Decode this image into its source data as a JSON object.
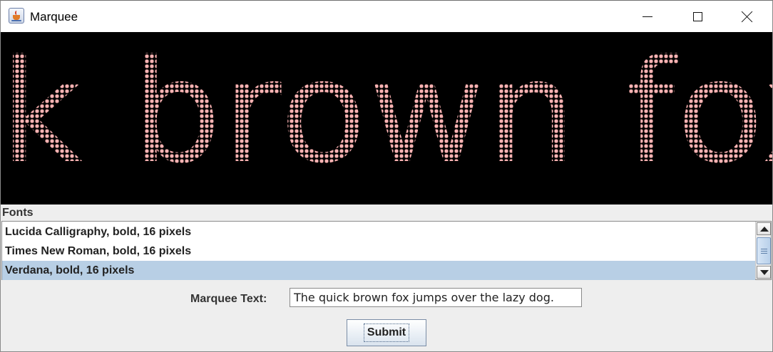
{
  "window": {
    "title": "Marquee",
    "icon": "java-cup-icon",
    "controls": [
      "minimize-icon",
      "maximize-icon",
      "close-icon"
    ]
  },
  "marquee": {
    "visible_text": "k brown fox ju",
    "dot_color": "#ffb3b3",
    "background_color": "#000000"
  },
  "fonts": {
    "label": "Fonts",
    "items": [
      {
        "label": "Lucida Calligraphy, bold, 16 pixels"
      },
      {
        "label": "Times New Roman, bold, 16 pixels"
      },
      {
        "label": "Verdana, bold, 16 pixels",
        "selected": true
      }
    ],
    "selected_color": "#b8cfe5"
  },
  "form": {
    "marquee_label": "Marquee Text:",
    "marquee_value": "The quick brown fox jumps over the lazy dog.",
    "submit_label": "Submit"
  }
}
